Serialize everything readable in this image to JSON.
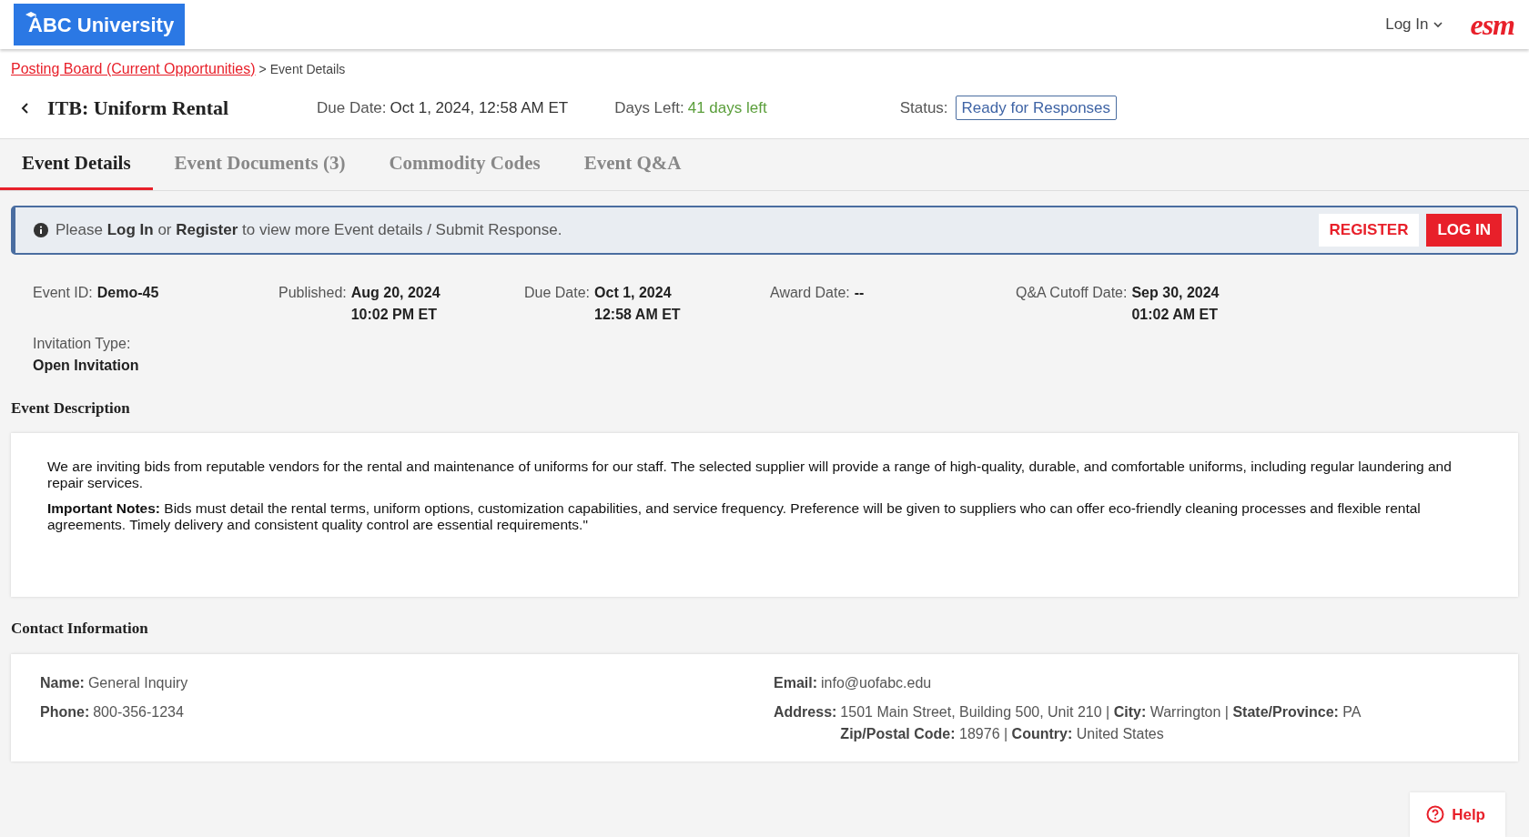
{
  "header": {
    "logo": "ABC University",
    "login_menu": "Log In",
    "brand": "esm"
  },
  "breadcrumb": {
    "link": "Posting Board (Current Opportunities)",
    "separator": ">",
    "current": "Event Details"
  },
  "title": "ITB: Uniform Rental",
  "summary": {
    "due_label": "Due Date:",
    "due_value": "Oct 1, 2024, 12:58 AM ET",
    "days_label": "Days Left:",
    "days_value": "41 days left",
    "status_label": "Status:",
    "status_value": "Ready for Responses"
  },
  "tabs": [
    {
      "label": "Event Details",
      "selected": true
    },
    {
      "label": "Event Documents (3)",
      "selected": false
    },
    {
      "label": "Commodity Codes",
      "selected": false
    },
    {
      "label": "Event Q&A",
      "selected": false
    }
  ],
  "notice": {
    "text": "Please **Log In** or **Register** to view more Event details / Submit Response.",
    "buttons": [
      {
        "label": "REGISTER",
        "kind": "outline"
      },
      {
        "label": "LOG IN",
        "kind": "solid"
      }
    ]
  },
  "details": [
    {
      "label": "Event ID:",
      "kind": "inline",
      "lines": [
        "Demo-45"
      ]
    },
    {
      "label": "Published:",
      "kind": "inline",
      "lines": [
        "Aug 20, 2024",
        "10:02 PM ET"
      ]
    },
    {
      "label": "Due Date:",
      "kind": "inline",
      "lines": [
        "Oct 1, 2024",
        "12:58 AM ET"
      ]
    },
    {
      "label": "Award Date:",
      "kind": "inline",
      "lines": [
        "--"
      ]
    },
    {
      "label": "Q&A Cutoff Date:",
      "kind": "inline",
      "lines": [
        "Sep 30, 2024",
        "01:02 AM ET"
      ]
    },
    {
      "label": "Invitation Type:",
      "kind": "stacked",
      "lines": [
        "Open Invitation"
      ]
    }
  ],
  "description": {
    "heading": "Event Description",
    "paragraphs": [
      "We are inviting bids from reputable vendors for the rental and maintenance of uniforms for our staff. The selected supplier will provide a range of high-quality, durable, and comfortable uniforms, including regular laundering and repair services.",
      "**Important Notes:** Bids must detail the rental terms, uniform options, customization capabilities, and service frequency. Preference will be given to suppliers who can offer eco-friendly cleaning processes and flexible rental agreements. Timely delivery and consistent quality control are essential requirements.\""
    ]
  },
  "contact": {
    "heading": "Contact Information",
    "columns": [
      [
        {
          "label": "Name:",
          "lines": [
            "General Inquiry"
          ]
        },
        {
          "label": "Phone:",
          "lines": [
            "800-356-1234"
          ]
        }
      ],
      [
        {
          "label": "Email:",
          "lines": [
            "info@uofabc.edu"
          ]
        },
        {
          "label": "Address:",
          "lines": [
            "1501 Main Street, Building 500, Unit 210 | **City:** Warrington | **State/Province:** PA",
            "**Zip/Postal Code:** 18976 | **Country:** United States"
          ]
        }
      ]
    ]
  },
  "help": "Help"
}
